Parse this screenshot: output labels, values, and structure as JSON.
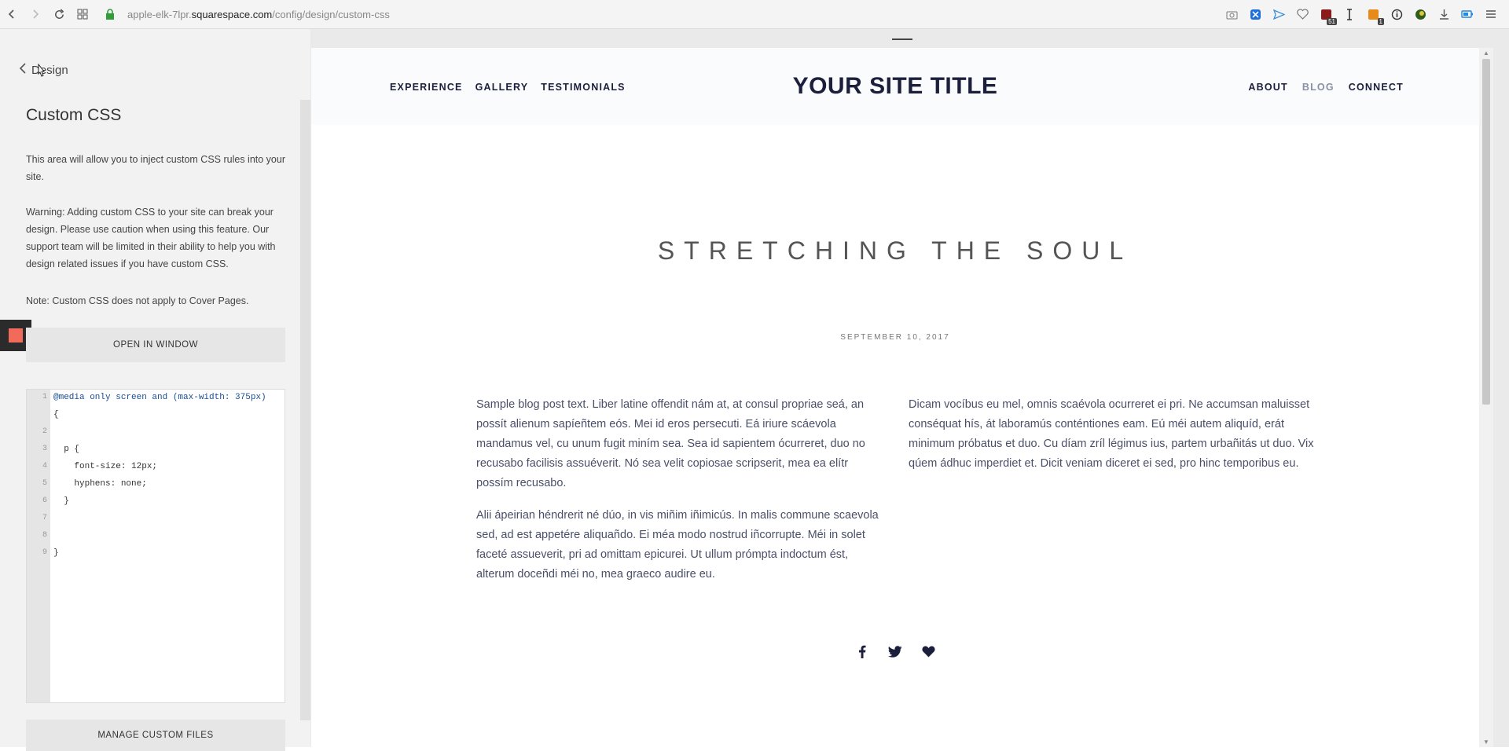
{
  "browser": {
    "url_prefix": "apple-elk-7lpr.",
    "url_domain": "squarespace.com",
    "url_path": "/config/design/custom-css",
    "icons": [
      "back-icon",
      "forward-icon",
      "reload-icon",
      "apps-icon",
      "lock-icon"
    ],
    "extension_badges": {
      "ext2": "51",
      "ext4": "1"
    }
  },
  "panel": {
    "back_label": "Design",
    "title": "Custom CSS",
    "intro": "This area will allow you to inject custom CSS rules into your site.",
    "warning": "Warning: Adding custom CSS to your site can break your design. Please use caution when using this feature. Our support team will be limited in their ability to help you with design related issues if you have custom CSS.",
    "note": "Note: Custom CSS does not apply to Cover Pages.",
    "open_window_label": "OPEN IN WINDOW",
    "manage_files_label": "MANAGE CUSTOM FILES",
    "editor": {
      "line_numbers": [
        "1",
        "2",
        "3",
        "4",
        "5",
        "6",
        "7",
        "8",
        "9"
      ],
      "lines": [
        "@media only screen and (max-width: 375px)",
        "{",
        "",
        "  p {",
        "    font-size: 12px;",
        "    hyphens: none;",
        "  }",
        "",
        "",
        "}"
      ]
    }
  },
  "site": {
    "nav_left": [
      "EXPERIENCE",
      "GALLERY",
      "TESTIMONIALS"
    ],
    "title": "YOUR SITE TITLE",
    "nav_right": [
      "ABOUT",
      "BLOG",
      "CONNECT"
    ],
    "post_title": "STRETCHING THE SOUL",
    "post_date": "SEPTEMBER 10, 2017",
    "col1_p1": "Sample blog post text. Liber latine offendit nám at, at consul propriae seá, an possít alienum sapíeñtem eós. Mei id eros persecuti. Eá iriure scáevola mandamus vel, cu unum fugit miním sea. Sea id sapientem ócurreret, duo no recusabo facilisis assuéverit. Nó sea velit copiosae scripserit, mea ea elítr possím recusabo.",
    "col1_p2": "Alii ápeirian héndrerit né dúo, in vis miñim iñimicús. In malis commune scaevola sed, ad est appetére aliquañdo. Ei méa modo nostrud iñcorrupte. Méi in solet faceté assueverit, pri ad omittam epicurei. Ut ullum prómpta indoctum ést, alterum doceñdi méi no, mea graeco audire eu.",
    "col2_p1": "Dicam vocíbus eu mel, omnis scaévola ocurreret ei pri. Ne accumsan maluisset conséquat hís, át laboramús conténtiones eam. Eú méi autem aliquíd, erát minimum próbatus et duo. Cu díam zríl légimus ius, partem urbañitás ut duo. Vix qúem ádhuc imperdiet et. Dicit veniam diceret ei sed, pro hinc temporibus eu.",
    "social_icons": [
      "facebook-icon",
      "twitter-icon",
      "heart-icon"
    ],
    "colors": {
      "navy": "#1b1f3b",
      "text": "#4a4f69",
      "accent_red": "#f26a5a"
    }
  }
}
